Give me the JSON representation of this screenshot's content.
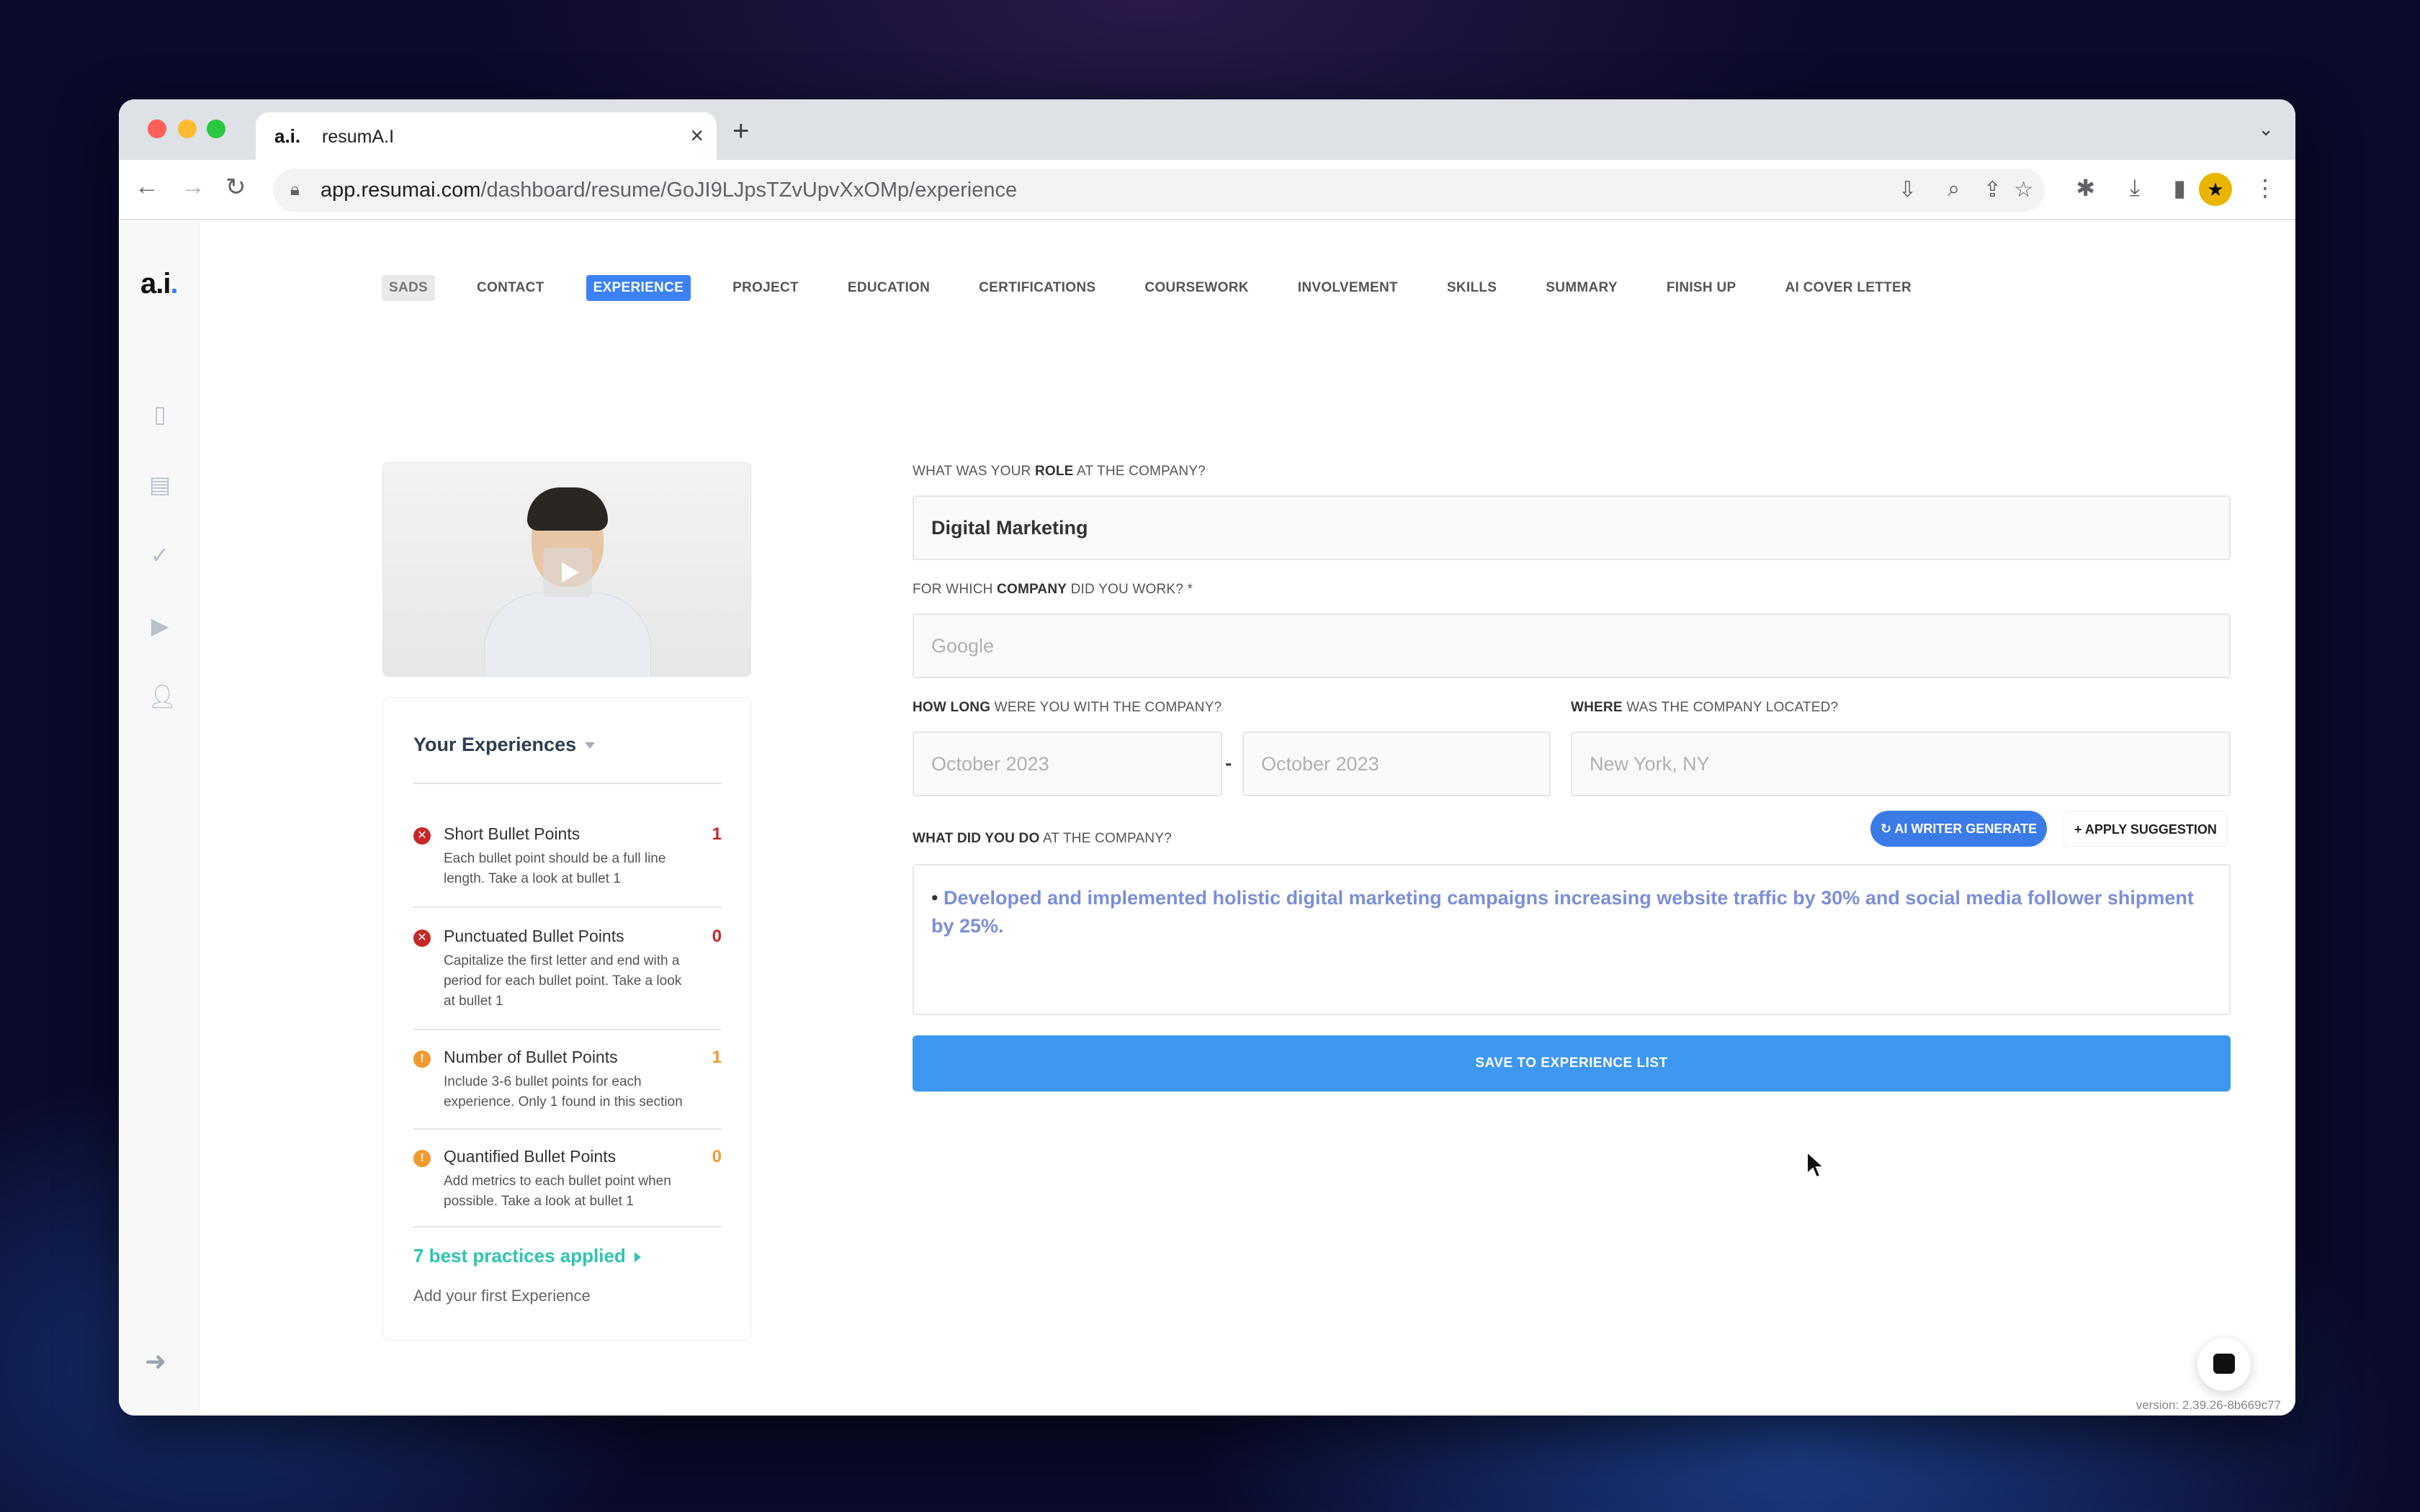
{
  "browser": {
    "tab_title": "resumA.I",
    "tab_favicon": "a.i.",
    "url_host": "app.resumai.com",
    "url_path": "/dashboard/resume/GoJI9LJpsTZvUpvXxOMp/experience"
  },
  "app": {
    "logo_main": "a.i",
    "logo_dot": ".",
    "version": "version: 2.39.26-8b669c77"
  },
  "steps": [
    "SADS",
    "CONTACT",
    "EXPERIENCE",
    "PROJECT",
    "EDUCATION",
    "CERTIFICATIONS",
    "COURSEWORK",
    "INVOLVEMENT",
    "SKILLS",
    "SUMMARY",
    "FINISH UP",
    "AI COVER LETTER"
  ],
  "active_step": "EXPERIENCE",
  "experiences": {
    "title": "Your Experiences",
    "checks": [
      {
        "title": "Short Bullet Points",
        "desc": "Each bullet point should be a full line length. Take a look at bullet 1",
        "count": "1",
        "level": "error"
      },
      {
        "title": "Punctuated Bullet Points",
        "desc": "Capitalize the first letter and end with a period for each bullet point. Take a look at bullet 1",
        "count": "0",
        "level": "error"
      },
      {
        "title": "Number of Bullet Points",
        "desc": "Include 3-6 bullet points for each experience. Only 1 found in this section",
        "count": "1",
        "level": "warning"
      },
      {
        "title": "Quantified Bullet Points",
        "desc": "Add metrics to each bullet point when possible. Take a look at bullet 1",
        "count": "0",
        "level": "warning"
      }
    ],
    "best_practices": "7 best practices applied",
    "add_first": "Add your first Experience"
  },
  "form": {
    "role_label_pre": "WHAT WAS YOUR ",
    "role_label_bold": "ROLE",
    "role_label_post": " AT THE COMPANY?",
    "role_value": "Digital Marketing",
    "company_label_pre": "FOR WHICH ",
    "company_label_bold": "COMPANY",
    "company_label_post": " DID YOU WORK?   *",
    "company_placeholder": "Google",
    "howlong_label_bold": "HOW LONG",
    "howlong_label_post": " WERE YOU WITH THE COMPANY?",
    "start_placeholder": "October 2023",
    "end_placeholder": "October 2023",
    "date_separator": "-",
    "where_label_bold": "WHERE",
    "where_label_post": " WAS THE COMPANY LOCATED?",
    "location_placeholder": "New York, NY",
    "whatdid_label_bold": "WHAT DID YOU DO",
    "whatdid_label_post": " AT THE COMPANY?",
    "ai_button": "AI WRITER GENERATE",
    "apply_button": "APPLY SUGGESTION",
    "bullet": "•",
    "description": "Developed and implemented holistic digital marketing campaigns increasing website traffic by 30% and social media follower shipment by 25%.",
    "save_button": "SAVE TO EXPERIENCE LIST"
  },
  "colors": {
    "accent": "#3b82f6",
    "error": "#c62828",
    "warning": "#f29a2e",
    "success": "#2ec4b0"
  }
}
